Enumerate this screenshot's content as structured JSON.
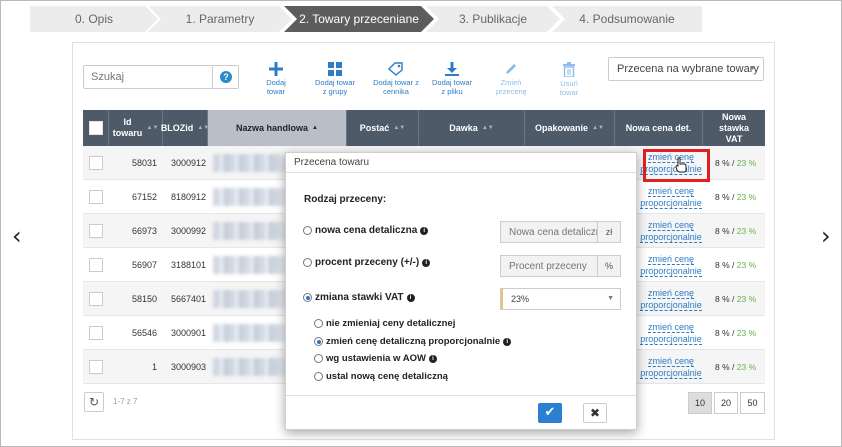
{
  "steps": [
    {
      "label": "0. Opis"
    },
    {
      "label": "1. Parametry"
    },
    {
      "label": "2. Towary przeceniane"
    },
    {
      "label": "3. Publikacje"
    },
    {
      "label": "4. Podsumowanie"
    }
  ],
  "search": {
    "placeholder": "Szukaj",
    "help": "?"
  },
  "toolbar": {
    "add_product": "Dodaj towar",
    "add_from_group": "Dodaj towar z grupy",
    "add_from_pricelist": "Dodaj towar z cennika",
    "add_from_file": "Dodaj towar z pliku",
    "change_price": "Zmień przecenę",
    "delete_product": "Usuń towar"
  },
  "scope_select": {
    "value": "Przecena na wybrane towary"
  },
  "table": {
    "columns": {
      "id": "Id towaru",
      "bloz": "BLOZid",
      "name": "Nazwa handlowa",
      "postac": "Postać",
      "dawka": "Dawka",
      "opakowanie": "Opakowanie",
      "new_price": "Nowa cena det.",
      "new_vat": "Nowa stawka VAT"
    },
    "rows": [
      {
        "id": "58031",
        "bloz": "3000912",
        "link1": "zmień cenę",
        "link2": "proporcjonalnie",
        "vat_old": "8 %",
        "vat_sep": " / ",
        "vat_new": "23 %"
      },
      {
        "id": "67152",
        "bloz": "8180912",
        "link1": "zmień cenę",
        "link2": "proporcjonalnie",
        "vat_old": "8 %",
        "vat_sep": " / ",
        "vat_new": "23 %"
      },
      {
        "id": "66973",
        "bloz": "3000992",
        "link1": "zmień cenę",
        "link2": "proporcjonalnie",
        "vat_old": "8 %",
        "vat_sep": " / ",
        "vat_new": "23 %"
      },
      {
        "id": "56907",
        "bloz": "3188101",
        "link1": "zmień cenę",
        "link2": "proporcjonalnie",
        "vat_old": "8 %",
        "vat_sep": " / ",
        "vat_new": "23 %"
      },
      {
        "id": "58150",
        "bloz": "5667401",
        "link1": "zmień cenę",
        "link2": "proporcjonalnie",
        "vat_old": "8 %",
        "vat_sep": " / ",
        "vat_new": "23 %"
      },
      {
        "id": "56546",
        "bloz": "3000901",
        "link1": "zmień cenę",
        "link2": "proporcjonalnie",
        "vat_old": "8 %",
        "vat_sep": " / ",
        "vat_new": "23 %"
      },
      {
        "id": "1",
        "bloz": "3000903",
        "link1": "zmień cenę",
        "link2": "proporcjonalnie",
        "vat_old": "8 %",
        "vat_sep": " / ",
        "vat_new": "23 %"
      }
    ],
    "count": "1-7 z 7",
    "page_sizes": [
      "10",
      "20",
      "50"
    ]
  },
  "modal": {
    "title": "Przecena towaru",
    "heading": "Rodzaj przeceny:",
    "opt_new_price": "nowa cena detaliczna",
    "new_price_placeholder": "Nowa cena detaliczna",
    "new_price_suffix": "zł",
    "opt_percent": "procent przeceny (+/-)",
    "percent_placeholder": "Procent przeceny",
    "percent_suffix": "%",
    "opt_vat": "zmiana stawki VAT",
    "vat_value": "23%",
    "sub_no_change": "nie zmieniaj ceny detalicznej",
    "sub_proportional": "zmień cenę detaliczną proporcjonalnie",
    "sub_aow": "wg ustawienia w AOW",
    "sub_set_new": "ustal nową cenę detaliczną",
    "ok": "✔",
    "cancel": "✖"
  },
  "colors": {
    "accent": "#2b7fd1",
    "header": "#4f5a68",
    "highlight": "#e02020",
    "vat_new": "#6ab04c"
  }
}
